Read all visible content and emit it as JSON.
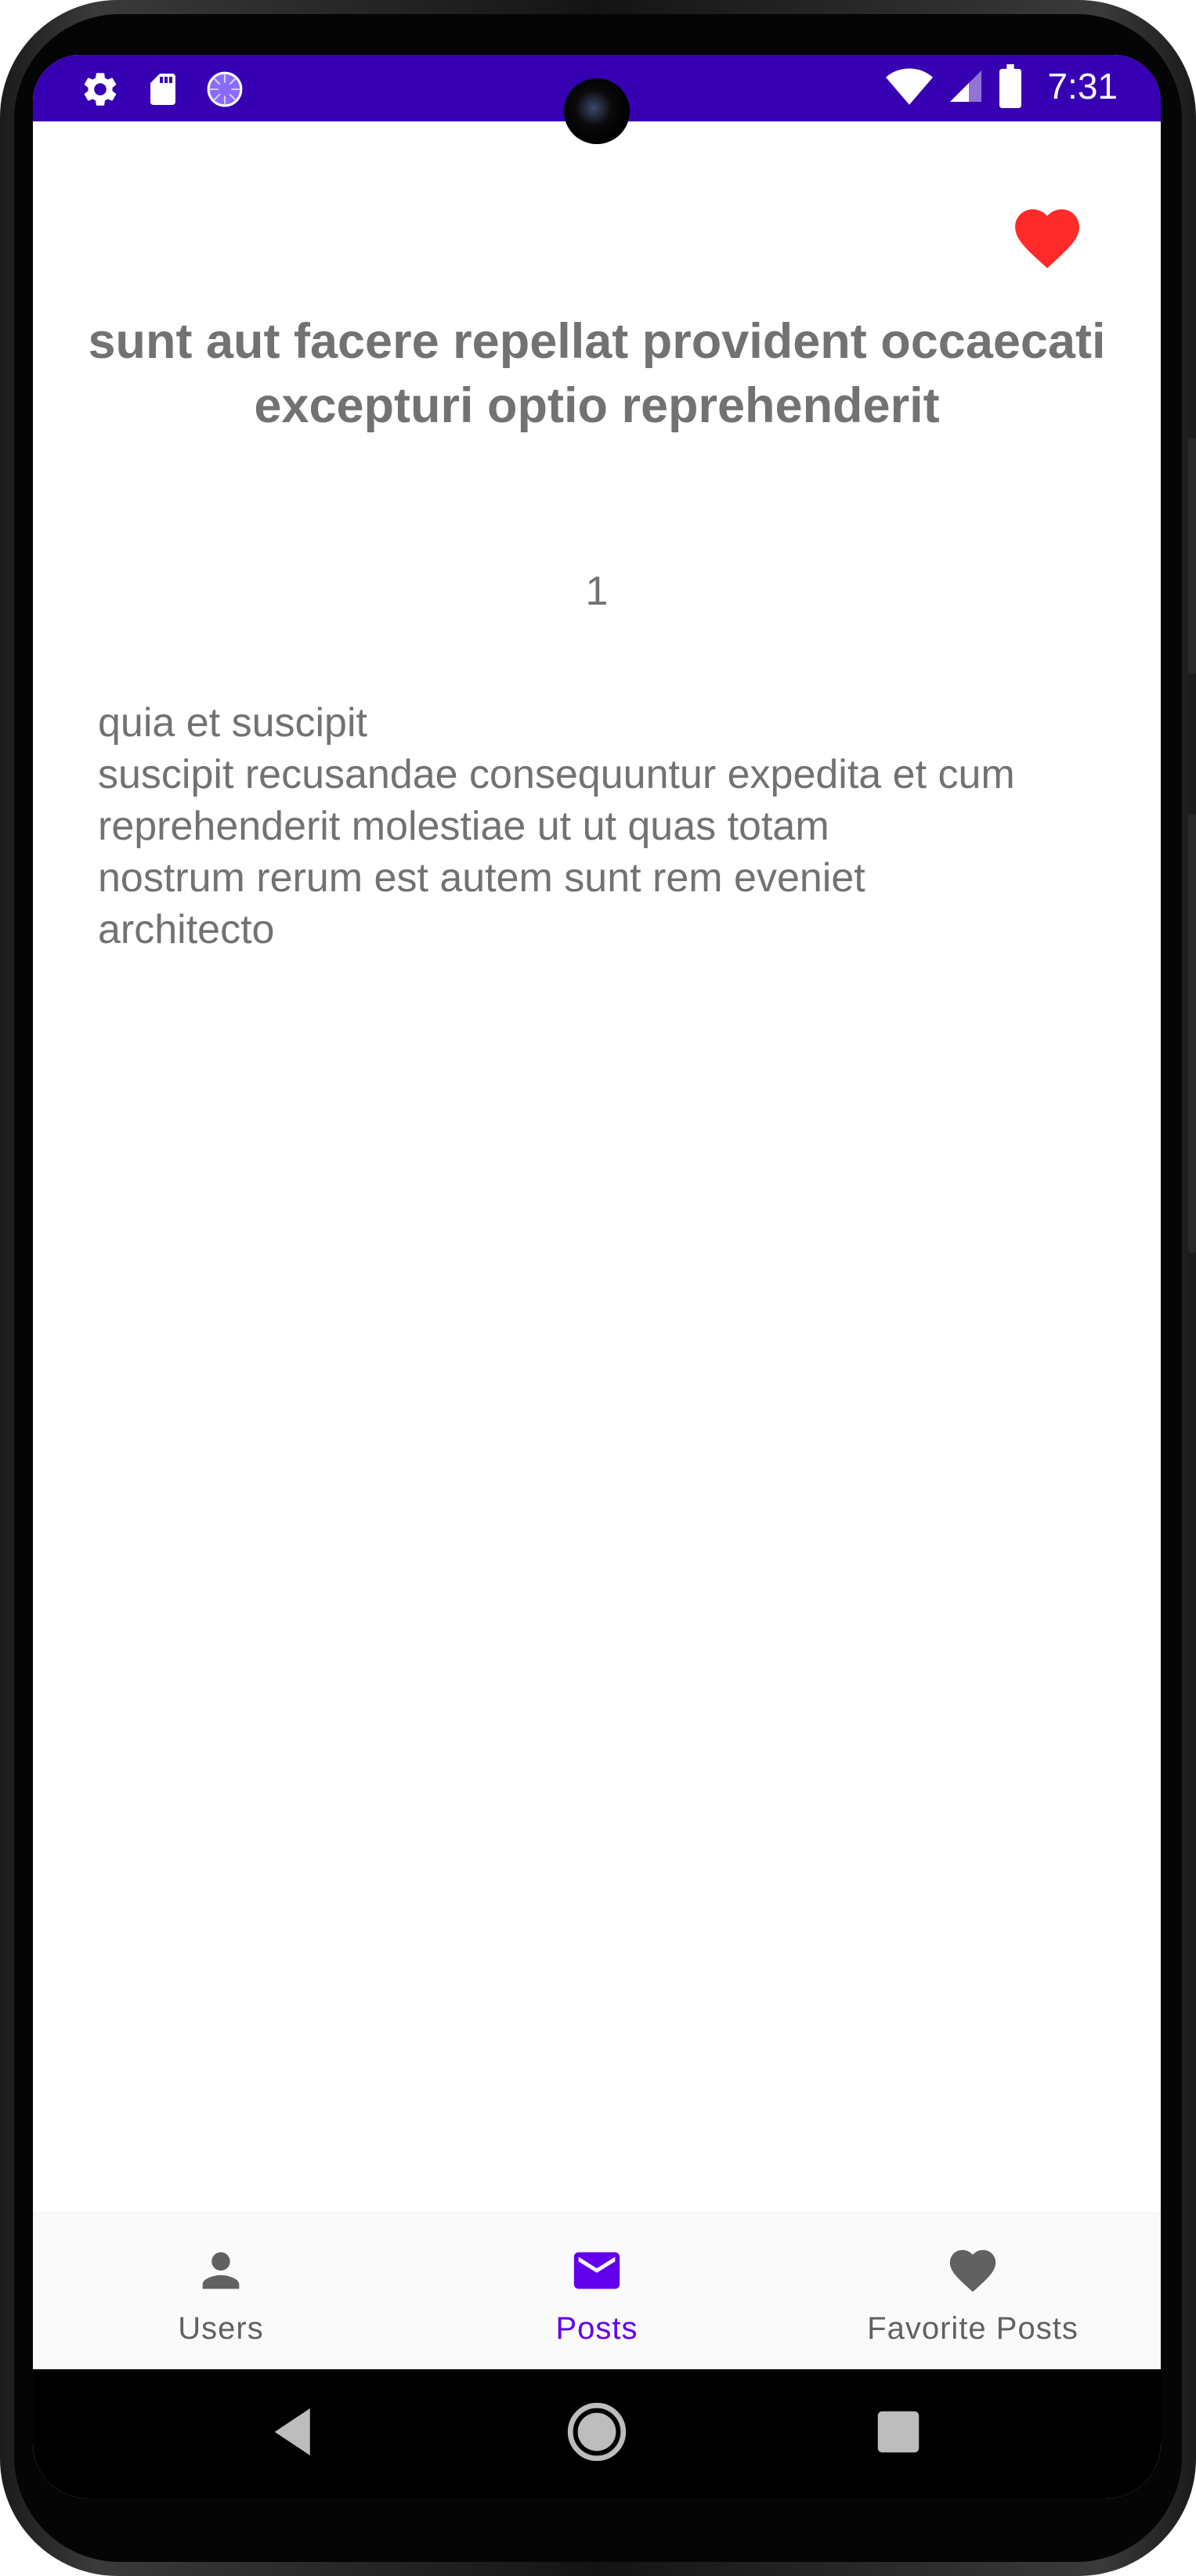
{
  "status_bar": {
    "time": "7:31",
    "icons_left": [
      "settings-icon",
      "sd-card-icon",
      "loading-icon"
    ],
    "icons_right": [
      "wifi-icon",
      "signal-icon",
      "battery-icon"
    ],
    "background_color": "#3700b3"
  },
  "post": {
    "title": "sunt aut facere repellat provident occaecati excepturi optio reprehenderit",
    "id": "1",
    "body": "quia et suscipit\nsuscipit recusandae consequuntur expedita et cum\nreprehenderit molestiae ut ut quas totam\nnostrum rerum est autem sunt rem eveniet\narchitecto",
    "favorite_icon": "heart-icon",
    "favorite_color": "#ff2a2a",
    "text_color": "#727272"
  },
  "bottom_nav": {
    "items": [
      {
        "label": "Users",
        "icon": "person-icon",
        "active": false
      },
      {
        "label": "Posts",
        "icon": "mail-icon",
        "active": true
      },
      {
        "label": "Favorite Posts",
        "icon": "heart-icon",
        "active": false
      }
    ],
    "active_color": "#6200ee",
    "inactive_color": "#616161"
  },
  "system_nav": {
    "buttons": [
      "back-icon",
      "home-icon",
      "recents-icon"
    ]
  }
}
